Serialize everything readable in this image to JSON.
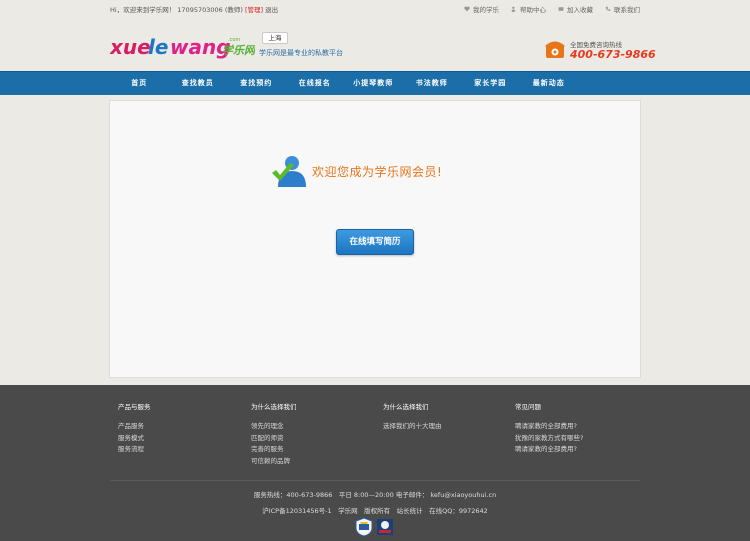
{
  "topbar": {
    "greeting_prefix": "Hi，欢迎来到学乐网！",
    "user": "17095703006 (教师)",
    "admin": "[管理]",
    "logout": "退出",
    "links": [
      {
        "label": "我的学乐",
        "icon": "heart-icon"
      },
      {
        "label": "帮助中心",
        "icon": "people-icon"
      },
      {
        "label": "加入收藏",
        "icon": "bookmark-icon"
      },
      {
        "label": "联系我们",
        "icon": "phone-icon"
      }
    ]
  },
  "header": {
    "logo_text": "xuelewang",
    "logo_cn": "学乐网",
    "logo_com": ".com",
    "city": "上海",
    "slogan": "学乐网是最专业的私教平台",
    "hotline_label": "全国免费咨询热线",
    "hotline_number": "400-673-9866"
  },
  "nav": {
    "items": [
      "首页",
      "查找教员",
      "查找预约",
      "在线报名",
      "小提琴教师",
      "书法教师",
      "家长学园",
      "最新动态"
    ]
  },
  "main": {
    "welcome": "欢迎您成为学乐网会员!",
    "resume_button": "在线填写简历"
  },
  "footer": {
    "columns": [
      {
        "heading": "产品与服务",
        "items": [
          "产品服务",
          "服务模式",
          "服务流程"
        ]
      },
      {
        "heading": "为什么选择我们",
        "items": [
          "领先的理念",
          "匹配的师资",
          "完善的服务",
          "可信赖的品牌"
        ]
      },
      {
        "heading": "为什么选择我们",
        "items": [
          "选择我们的十大理由"
        ]
      },
      {
        "heading": "常见问题",
        "items": [
          "聘请家教的全部费用?",
          "犹豫的家教方式有哪些?",
          "聘请家教的全部费用?"
        ]
      }
    ],
    "contact_line": "服务热线：400-673-9866　平日 8:00—20:00 电子邮件： kefu@xiaoyouhui.cn",
    "icp_line": "沪ICP备12031456号-1　学乐网　版权所有　站长统计　在线QQ：9972642"
  },
  "colors": {
    "nav_bg": "#1b6ea8",
    "accent_orange": "#e8751a",
    "hotline_red": "#e8391f",
    "button_blue": "#2784d0",
    "footer_bg": "#4a4a4a"
  }
}
